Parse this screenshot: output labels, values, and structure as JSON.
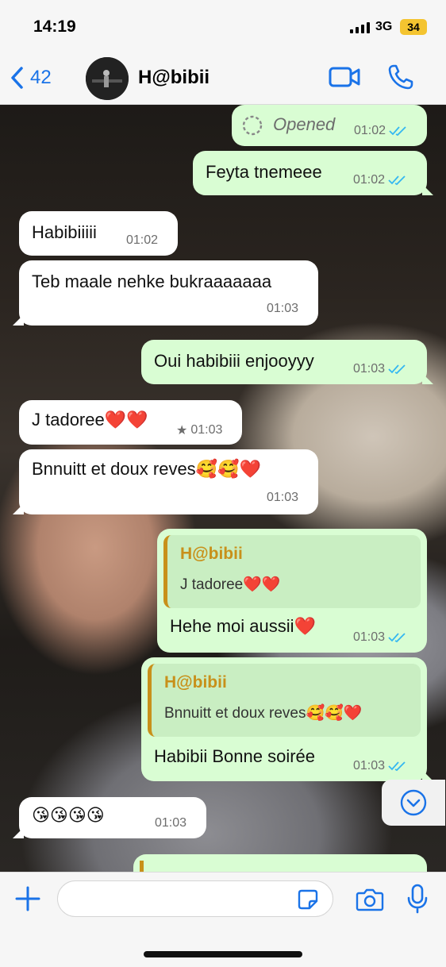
{
  "status_bar": {
    "time": "14:19",
    "network": "3G",
    "battery": "34"
  },
  "header": {
    "back_count": "42",
    "contact_name": "H@bibii"
  },
  "messages": [
    {
      "dir": "out",
      "text": "Opened",
      "time": "01:02",
      "ticks": "read",
      "style": "opened"
    },
    {
      "dir": "out",
      "text": "Feyta tnemeee",
      "time": "01:02",
      "ticks": "read"
    },
    {
      "dir": "in",
      "text": "Habibiiiii",
      "time": "01:02"
    },
    {
      "dir": "in",
      "text": "Teb maale nehke bukraaaaaaa",
      "time": "01:03"
    },
    {
      "dir": "out",
      "text": "Oui habibiii enjooyyy",
      "time": "01:03",
      "ticks": "read"
    },
    {
      "dir": "in",
      "text": "J tadoree❤️❤️",
      "time": "01:03",
      "starred": true,
      "star": "★"
    },
    {
      "dir": "in",
      "text": "Bnnuitt et doux reves🥰🥰❤️",
      "time": "01:03"
    },
    {
      "dir": "out",
      "quote_author": "H@bibii",
      "quote_text": "J tadoree❤️❤️",
      "text": "Hehe moi aussii❤️",
      "time": "01:03",
      "ticks": "read"
    },
    {
      "dir": "out",
      "quote_author": "H@bibii",
      "quote_text": "Bnnuitt et doux reves🥰🥰❤️",
      "text": "Habibii Bonne soirée",
      "time": "01:03",
      "ticks": "read"
    },
    {
      "dir": "in",
      "text": "😘😘😘😘",
      "time": "01:03"
    }
  ],
  "input": {
    "placeholder": ""
  },
  "colors": {
    "accent": "#1a73e8",
    "outgoing_bubble": "#d9fdd3",
    "incoming_bubble": "#ffffff",
    "quote_author": "#c8901a",
    "read_ticks": "#34b7f1"
  }
}
